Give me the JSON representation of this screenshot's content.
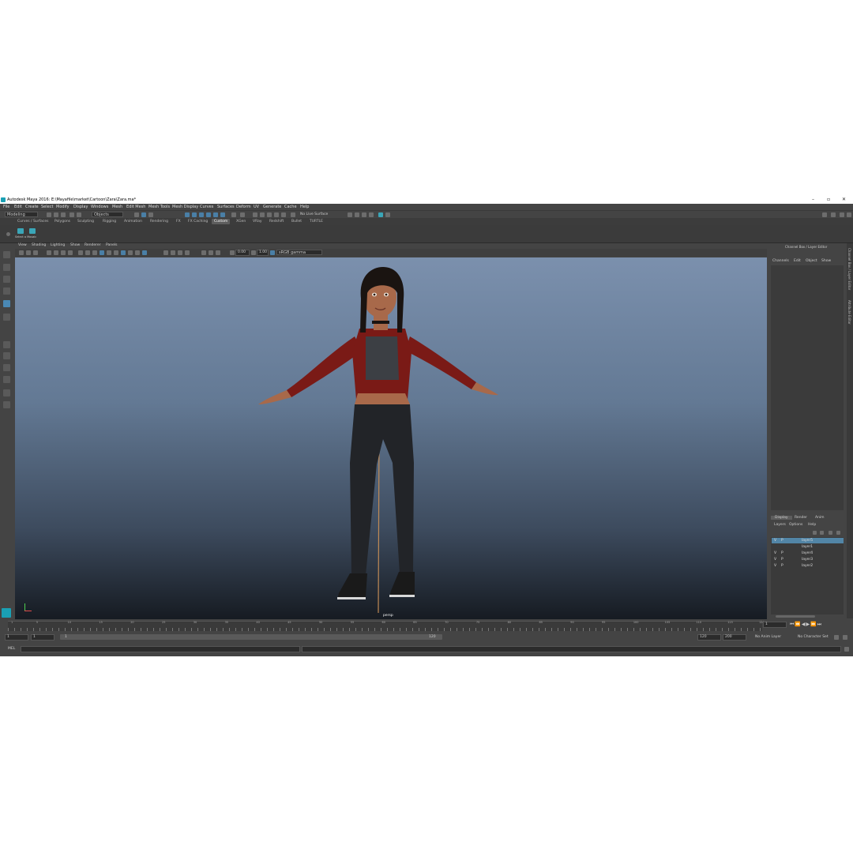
{
  "window": {
    "title": "Autodesk Maya 2016: E:\\Mayafile\\market\\Cartoon\\Zara\\Zara.ma*",
    "minimize": "–",
    "maximize": "▫",
    "close": "✕"
  },
  "menu": [
    "File",
    "Edit",
    "Create",
    "Select",
    "Modify",
    "Display",
    "Windows",
    "Mesh",
    "Edit Mesh",
    "Mesh Tools",
    "Mesh Display",
    "Curves",
    "Surfaces",
    "Deform",
    "UV",
    "Generate",
    "Cache",
    "Help"
  ],
  "status": {
    "mode": "Modeling",
    "objects_field": "Objects",
    "live_surface": "No Live Surface"
  },
  "shelf_tabs": [
    "Curves / Surfaces",
    "Polygons",
    "Sculpting",
    "Rigging",
    "Animation",
    "Rendering",
    "FX",
    "FX Caching",
    "Custom",
    "XGen",
    "VRay",
    "Redshift",
    "Bullet",
    "TURTLE"
  ],
  "shelf_active": "Custom",
  "shelf_button_label": "Select a Mosaic",
  "panel_menu": [
    "View",
    "Shading",
    "Lighting",
    "Show",
    "Renderer",
    "Panels"
  ],
  "panel_toolbar": {
    "value_a": "0.00",
    "value_b": "1.00",
    "colorspace": "sRGB gamma"
  },
  "viewport": {
    "camera": "persp"
  },
  "channel_box": {
    "title": "Channel Box / Layer Editor",
    "menus": [
      "Channels",
      "Edit",
      "Object",
      "Show"
    ]
  },
  "layer_editor": {
    "tabs": [
      "Display",
      "Render",
      "Anim"
    ],
    "menus": [
      "Layers",
      "Options",
      "Help"
    ],
    "layers": [
      {
        "v": "V",
        "p": "P",
        "name": "layer5",
        "selected": true
      },
      {
        "v": "",
        "p": "",
        "name": "layer1",
        "selected": false
      },
      {
        "v": "V",
        "p": "P",
        "name": "layer4",
        "selected": false
      },
      {
        "v": "V",
        "p": "P",
        "name": "layer3",
        "selected": false
      },
      {
        "v": "V",
        "p": "P",
        "name": "layer2",
        "selected": false
      }
    ]
  },
  "side_tabs": [
    "Channel Box / Layer Editor",
    "Attribute Editor"
  ],
  "time": {
    "ticks": [
      "1",
      "5",
      "10",
      "15",
      "20",
      "25",
      "30",
      "35",
      "40",
      "45",
      "50",
      "55",
      "60",
      "65",
      "70",
      "75",
      "80",
      "85",
      "90",
      "95",
      "100",
      "105",
      "110",
      "115",
      "120"
    ],
    "current_frame": "1",
    "range_start": "1",
    "playback_start": "1",
    "range_field_left": "1",
    "range_field_right": "120",
    "range_end": "120",
    "anim_end": "200",
    "anim_layer": "No Anim Layer",
    "char_set": "No Character Set"
  },
  "command": {
    "label": "MEL"
  },
  "colors": {
    "accent": "#4a88b4",
    "ui_bg": "#444444",
    "layer_selected": "#5285a6"
  },
  "character": {
    "jacket": "#7a1a16",
    "top": "#3c3f44",
    "jeans": "#222428",
    "skin": "#a8694a",
    "hair": "#1a1411"
  }
}
